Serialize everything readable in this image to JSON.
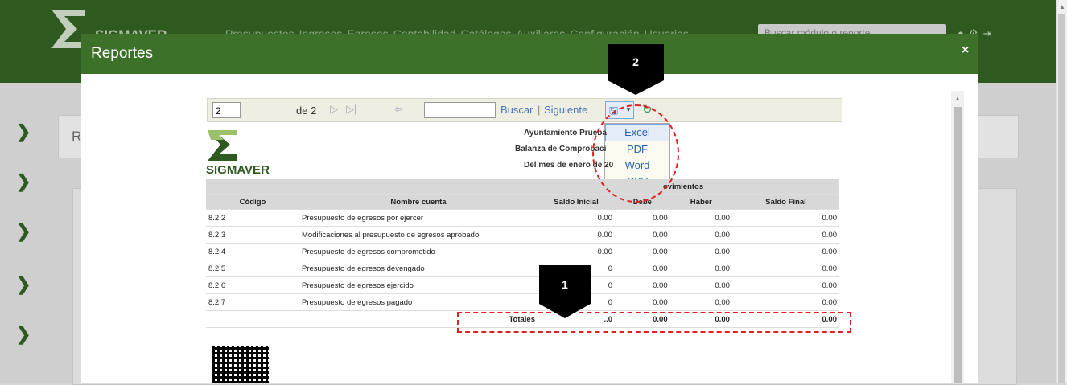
{
  "app": {
    "brand": "SIGMAVER",
    "search_placeholder": "Buscar módulo o reporte",
    "menu": [
      "Presupuestos",
      "Ingresos",
      "Egresos",
      "Contabilidad",
      "Catálogos",
      "Auxiliares",
      "Configuración",
      "Usuarios"
    ]
  },
  "background": {
    "section_initial": "R"
  },
  "modal": {
    "title": "Reportes",
    "close": "×"
  },
  "toolbar": {
    "page_value": "2",
    "page_of": "de 2",
    "find_label": "Buscar",
    "separator": "|",
    "next_label": "Siguiente"
  },
  "export_menu": {
    "options": [
      "Excel",
      "PDF",
      "Word",
      "CSV"
    ]
  },
  "report": {
    "brand": "SIGMAVER",
    "header_lines": [
      "Ayuntamiento Prueba",
      "Balanza de Comprobaci",
      "Del mes de enero de 20"
    ],
    "group_header": "ovimientos",
    "columns": [
      "Código",
      "Nombre cuenta",
      "Saldo Inicial",
      "Debe",
      "Haber",
      "Saldo Final"
    ],
    "rows": [
      [
        "8.2.2",
        "Presupuesto de egresos por ejercer",
        "0.00",
        "0.00",
        "0.00",
        "0.00"
      ],
      [
        "8.2.3",
        "Modificaciones al presupuesto de egresos aprobado",
        "0.00",
        "0.00",
        "0.00",
        "0.00"
      ],
      [
        "8.2.4",
        "Presupuesto de egresos comprometido",
        "0.00",
        "0.00",
        "0.00",
        "0.00"
      ],
      [
        "8.2.5",
        "Presupuesto de egresos devengado",
        "0",
        "0.00",
        "0.00",
        "0.00"
      ],
      [
        "8.2.6",
        "Presupuesto de egresos ejercido",
        "0",
        "0.00",
        "0.00",
        "0.00"
      ],
      [
        "8.2.7",
        "Presupuesto de egresos pagado",
        "0",
        "0.00",
        "0.00",
        "0.00"
      ]
    ],
    "totals_label": "Totales",
    "totals": [
      "..0",
      "0.00",
      "0.00",
      "0.00"
    ]
  },
  "callouts": {
    "one": "1",
    "two": "2"
  }
}
